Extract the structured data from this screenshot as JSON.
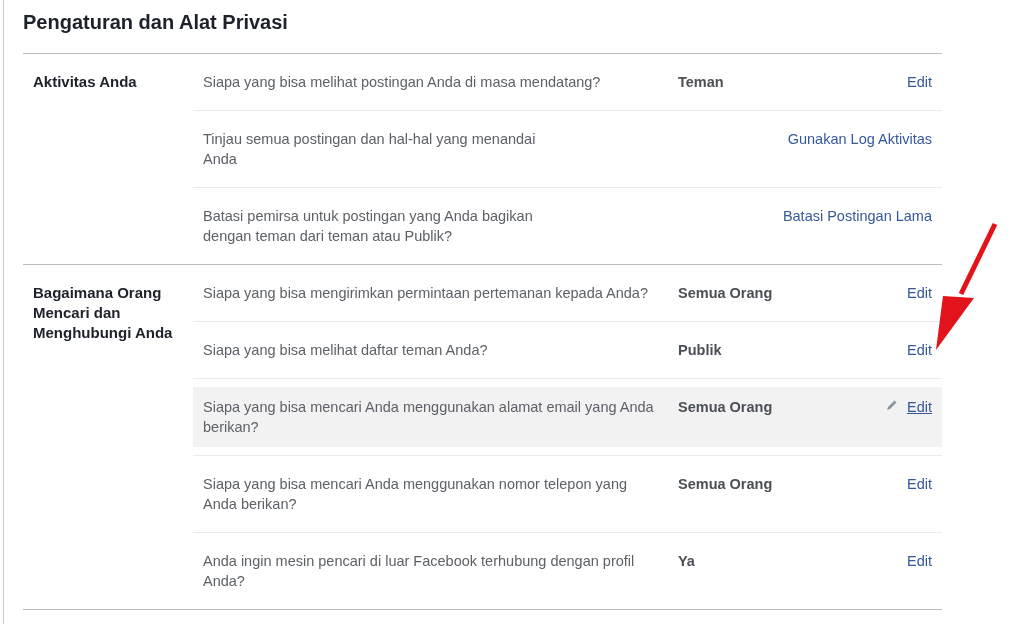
{
  "title": "Pengaturan dan Alat Privasi",
  "sections": [
    {
      "label": "Aktivitas Anda",
      "rows": [
        {
          "question": "Siapa yang bisa melihat postingan Anda di masa mendatang?",
          "value": "Teman",
          "action": "Edit",
          "hovered": false
        },
        {
          "question": "Tinjau semua postingan dan hal-hal yang menandai Anda",
          "action": "Gunakan Log Aktivitas",
          "hovered": false
        },
        {
          "question": "Batasi pemirsa untuk postingan yang Anda bagikan dengan teman dari teman atau Publik?",
          "action": "Batasi Postingan Lama",
          "hovered": false
        }
      ]
    },
    {
      "label": "Bagaimana Orang Mencari dan Menghubungi Anda",
      "rows": [
        {
          "question": "Siapa yang bisa mengirimkan permintaan pertemanan kepada Anda?",
          "value": "Semua Orang",
          "action": "Edit",
          "hovered": false
        },
        {
          "question": "Siapa yang bisa melihat daftar teman Anda?",
          "value": "Publik",
          "action": "Edit",
          "hovered": false
        },
        {
          "question": "Siapa yang bisa mencari Anda menggunakan alamat email yang Anda berikan?",
          "value": "Semua Orang",
          "action": "Edit",
          "hovered": true
        },
        {
          "question": "Siapa yang bisa mencari Anda menggunakan nomor telepon yang Anda berikan?",
          "value": "Semua Orang",
          "action": "Edit",
          "hovered": false
        },
        {
          "question": "Anda ingin mesin pencari di luar Facebook terhubung dengan profil Anda?",
          "value": "Ya",
          "action": "Edit",
          "hovered": false
        }
      ]
    }
  ]
}
